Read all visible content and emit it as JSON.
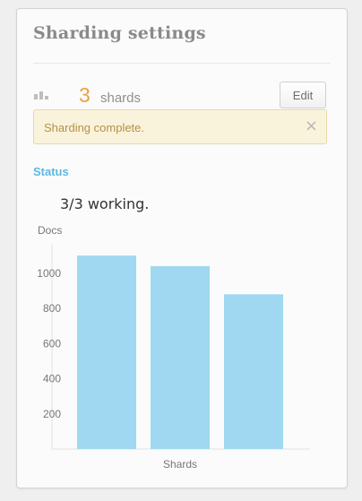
{
  "panel": {
    "title": "Sharding settings",
    "shard_count": "3",
    "shard_label": "shards",
    "edit_label": "Edit",
    "alert_text": "Sharding complete.",
    "alert_close": "×",
    "status_label": "Status",
    "status_text": "3/3 working."
  },
  "icons": {
    "bars": "bar-chart-icon",
    "close": "close-icon"
  },
  "colors": {
    "accent": "#e8a33d",
    "status": "#5db9df",
    "bar": "#a0d8f2",
    "alert_bg": "#faf3dc"
  },
  "chart_data": {
    "type": "bar",
    "categories": [
      "",
      "",
      ""
    ],
    "values": [
      1100,
      1040,
      880
    ],
    "xlabel": "Shards",
    "ylabel": "Docs",
    "yticks": [
      200,
      400,
      600,
      800,
      1000
    ],
    "ylim": [
      0,
      1250
    ],
    "grid": false
  }
}
